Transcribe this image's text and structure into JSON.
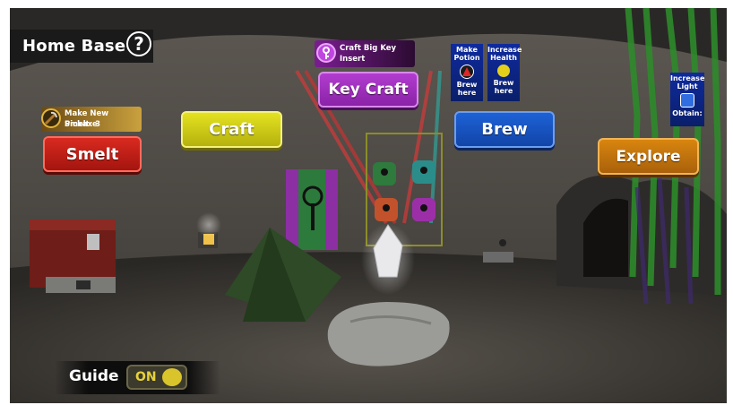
{
  "hud": {
    "title": "Home Base",
    "help_symbol": "?"
  },
  "buttons": {
    "smelt": "Smelt",
    "craft": "Craft",
    "key_craft": "Key Craft",
    "brew": "Brew",
    "explore": "Explore"
  },
  "tooltips": {
    "pickaxe": {
      "line1": "Make New Pickaxe",
      "line2": "Smelt: 3",
      "icon": "pickaxe-icon"
    },
    "big_key": {
      "line1": "Craft Big Key",
      "line2": "Insert",
      "icon": "key-icon"
    },
    "potion": {
      "line1": "Make",
      "line2": "Potion",
      "line3": "Brew",
      "line4": "here",
      "icon": "flask-icon"
    },
    "health": {
      "line1": "Increase",
      "line2": "Health",
      "line3": "Brew",
      "line4": "here",
      "icon": "bulb-icon"
    },
    "light": {
      "line1": "Increase",
      "line2": "Light",
      "line3": "Obtain:",
      "icon": "lantern-icon"
    }
  },
  "guide": {
    "label": "Guide",
    "state": "ON"
  },
  "colors": {
    "smelt": "#c41e16",
    "craft": "#d6d314",
    "key_craft": "#a030c0",
    "brew": "#1a55c8",
    "explore": "#c9780c"
  }
}
